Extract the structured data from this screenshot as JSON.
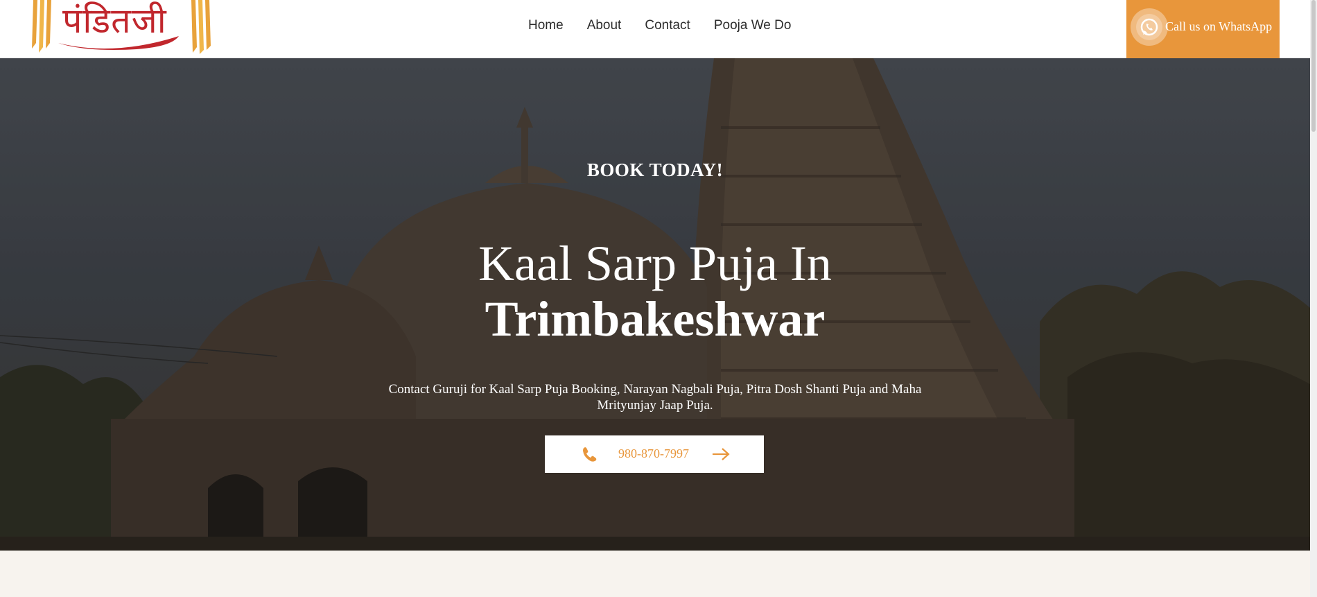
{
  "header": {
    "logo_text": "पंडितजी",
    "nav": [
      {
        "label": "Home"
      },
      {
        "label": "About"
      },
      {
        "label": "Contact"
      },
      {
        "label": "Pooja We Do"
      }
    ],
    "whatsapp_label": "Call us on WhatsApp"
  },
  "hero": {
    "eyebrow": "BOOK TODAY!",
    "title_line1": "Kaal Sarp Puja In",
    "title_line2": "Trimbakeshwar",
    "subtitle": "Contact Guruji for Kaal Sarp Puja Booking, Narayan Nagbali Puja, Pitra Dosh Shanti Puja and Maha Mrityunjay Jaap Puja.",
    "phone": "980-870-7997"
  },
  "colors": {
    "accent": "#e8963b",
    "logo_red": "#c1272d",
    "page_bg": "#f7f3ee"
  },
  "icons": {
    "whatsapp": "whatsapp-icon",
    "phone": "phone-icon",
    "arrow": "arrow-right-icon"
  }
}
